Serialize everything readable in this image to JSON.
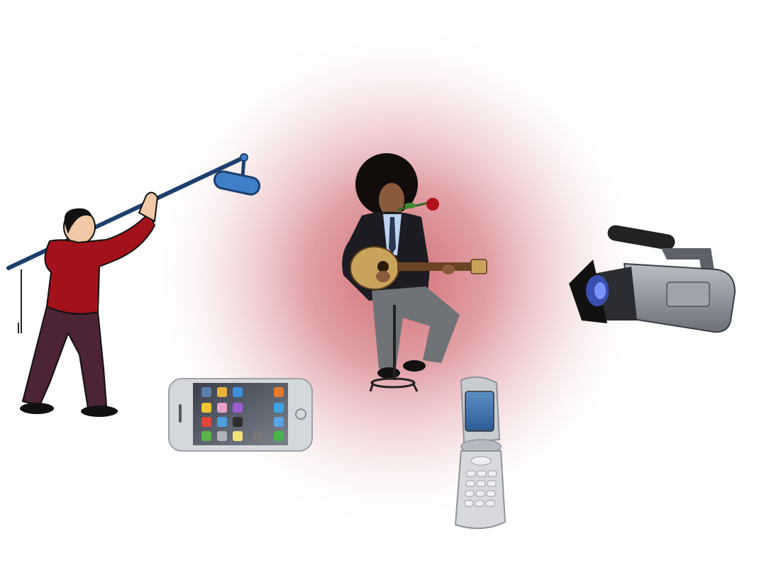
{
  "scene": {
    "center_glow_color": "#c9545c",
    "background_color": "#ffffff",
    "objects": [
      {
        "id": "boom-operator",
        "label_icon": "boom-microphone-operator-icon"
      },
      {
        "id": "guitarist",
        "label_icon": "guitarist-with-rose-icon"
      },
      {
        "id": "video-camera",
        "label_icon": "video-camera-icon"
      },
      {
        "id": "smartphone",
        "label_icon": "smartphone-icon"
      },
      {
        "id": "flip-phone",
        "label_icon": "flip-phone-icon"
      }
    ]
  },
  "colors": {
    "sweater_red": "#a3121b",
    "pants_purple": "#4b2436",
    "boom_pole": "#1d3f6e",
    "mic_blue": "#3f7fc8",
    "suit_dark": "#1c1c22",
    "jeans_gray": "#6f7276",
    "guitar_wood": "#c9a35c",
    "rose_red": "#b3121c",
    "camera_gray": "#8a8e97",
    "phone_silver": "#d4d7dc"
  }
}
